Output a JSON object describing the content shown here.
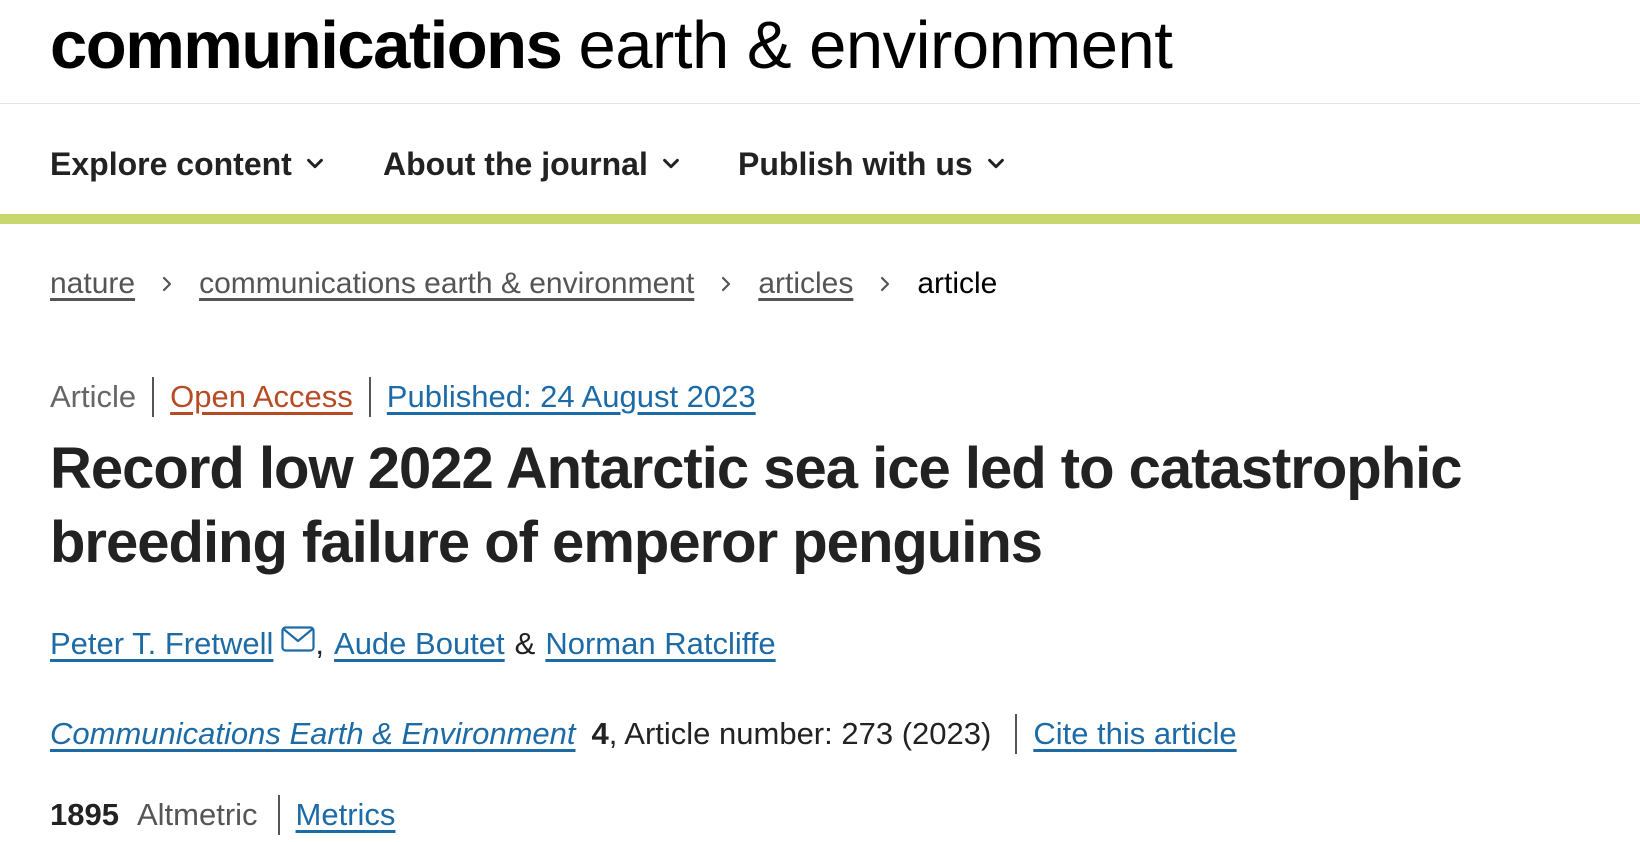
{
  "journal": {
    "name_bold": "communications",
    "name_light": "earth & environment"
  },
  "nav": {
    "items": [
      {
        "label": "Explore content",
        "icon": "chevron-down-icon"
      },
      {
        "label": "About the journal",
        "icon": "chevron-down-icon"
      },
      {
        "label": "Publish with us",
        "icon": "chevron-down-icon"
      }
    ],
    "accent_color": "#c9d86e"
  },
  "breadcrumb": {
    "items": [
      "nature",
      "communications earth & environment",
      "articles"
    ],
    "current": "article",
    "separator_icon": "chevron-right-icon"
  },
  "meta": {
    "type": "Article",
    "access": "Open Access",
    "published": "Published: 24 August 2023"
  },
  "article": {
    "title": "Record low 2022 Antarctic sea ice led to catastrophic breeding failure of emperor penguins"
  },
  "authors": {
    "list": [
      "Peter T. Fretwell",
      "Aude Boutet",
      "Norman Ratcliffe"
    ],
    "comma": ",",
    "ampersand": "&",
    "contact_icon": "envelope-icon"
  },
  "citation": {
    "journal": "Communications Earth & Environment",
    "volume": "4",
    "details": ", Article number: 273 (2023)",
    "cite_label": "Cite this article"
  },
  "metrics": {
    "altmetric_score": "1895",
    "altmetric_label": "Altmetric",
    "metrics_label": "Metrics"
  },
  "colors": {
    "link": "#1d6ba6",
    "open_access": "#b64c25",
    "text": "#222222"
  }
}
